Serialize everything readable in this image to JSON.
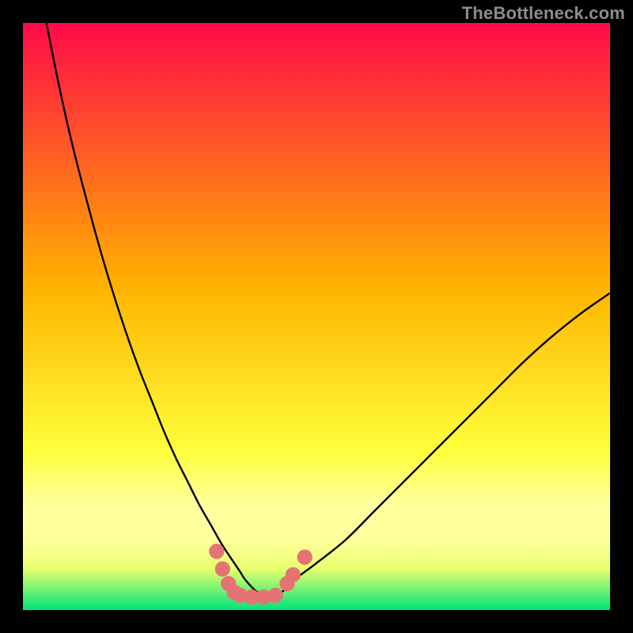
{
  "watermark": "TheBottleneck.com",
  "chart_data": {
    "type": "line",
    "title": "",
    "xlabel": "",
    "ylabel": "",
    "xlim": [
      0,
      100
    ],
    "ylim": [
      0,
      100
    ],
    "grid": false,
    "legend": false,
    "background_gradient": {
      "top_color": "#ff0a48",
      "mid_color_1": "#ffb300",
      "mid_color_2": "#ffff3c",
      "bottom_color": "#00e37a",
      "highlight_band": "#ffff9e"
    },
    "series": [
      {
        "name": "bottleneck-curve",
        "color": "#000000",
        "x": [
          4,
          6,
          8,
          10,
          12,
          14,
          16,
          18,
          20,
          22,
          24,
          26,
          28,
          30,
          32,
          34,
          36,
          37,
          38,
          40,
          42,
          44,
          46,
          50,
          55,
          60,
          65,
          70,
          75,
          80,
          85,
          90,
          95,
          100
        ],
        "y": [
          100,
          90,
          81,
          73,
          65.5,
          58.5,
          52,
          46,
          40.5,
          35.5,
          30.5,
          26,
          22,
          18,
          14.5,
          11,
          8,
          6.5,
          5,
          3,
          2.5,
          3,
          5,
          8,
          12,
          17,
          22,
          27,
          32,
          37,
          42,
          46.5,
          50.5,
          54
        ]
      }
    ],
    "markers": {
      "name": "highlight-dots",
      "color": "#e57373",
      "radius_pct": 1.3,
      "points": [
        {
          "x": 33,
          "y": 10
        },
        {
          "x": 34,
          "y": 7
        },
        {
          "x": 35,
          "y": 4.5
        },
        {
          "x": 36,
          "y": 3
        },
        {
          "x": 37,
          "y": 2.5
        },
        {
          "x": 39,
          "y": 2.2
        },
        {
          "x": 41,
          "y": 2.2
        },
        {
          "x": 43,
          "y": 2.5
        },
        {
          "x": 45,
          "y": 4.5
        },
        {
          "x": 46,
          "y": 6
        },
        {
          "x": 48,
          "y": 9
        }
      ]
    }
  }
}
